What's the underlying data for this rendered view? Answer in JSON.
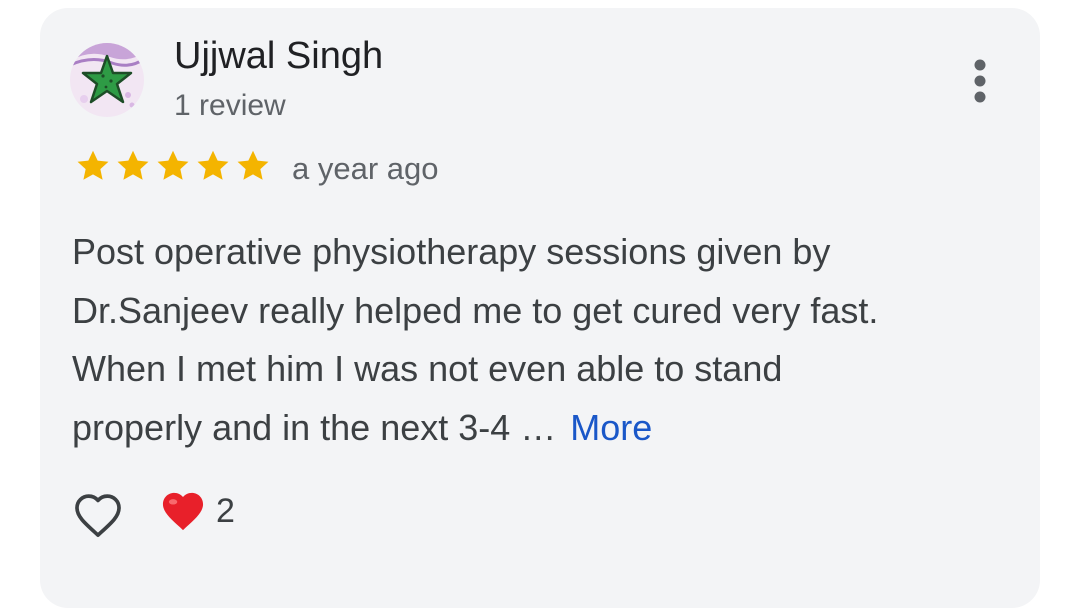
{
  "review": {
    "author_name": "Ujjwal Singh",
    "review_count": "1 review",
    "rating": 5,
    "rating_max": 5,
    "timestamp": "a year ago",
    "text_lines": [
      "Post operative physiotherapy sessions given by",
      "Dr.Sanjeev really helped me to get cured very fast.",
      "When I met him I was not even able to stand",
      "properly and in the next 3-4 …"
    ],
    "more_label": "More",
    "reaction_count": "2"
  },
  "icons": {
    "avatar": "starfish-avatar",
    "menu": "more-vert-icon",
    "star": "star-icon",
    "like": "heart-outline-icon",
    "reaction": "red-heart-icon"
  },
  "colors": {
    "star": "#f4b400",
    "link": "#1a57c8",
    "card_bg": "#f3f4f6",
    "heart": "#e8202a"
  }
}
